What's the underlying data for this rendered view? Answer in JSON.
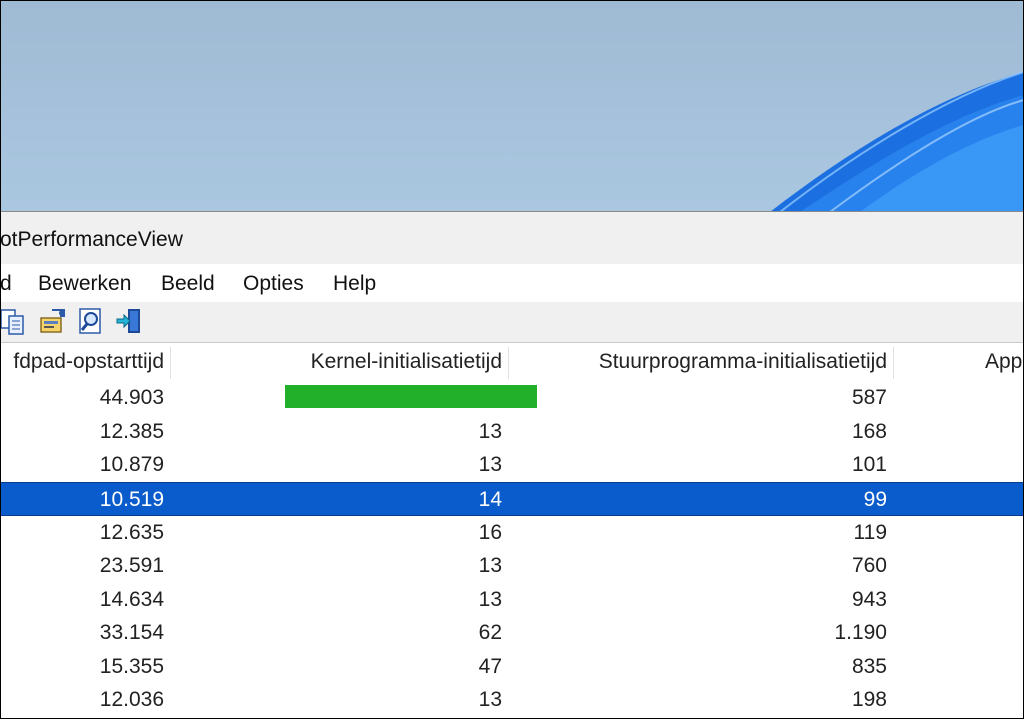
{
  "window": {
    "title": "otPerformanceView"
  },
  "menu": [
    "d",
    "Bewerken",
    "Beeld",
    "Opties",
    "Help"
  ],
  "toolbar_icons": [
    "copy-icon",
    "properties-icon",
    "find-icon",
    "exit-icon"
  ],
  "columns": [
    "fdpad-opstarttijd",
    "Kernel-initialisatietijd",
    "Stuurprogramma-initialisatietijd",
    "App"
  ],
  "rows": [
    {
      "boot": "44.903",
      "kernel": "",
      "kernel_bar_percent": 100,
      "driver": "587",
      "selected": false
    },
    {
      "boot": "12.385",
      "kernel": "13",
      "driver": "168",
      "selected": false
    },
    {
      "boot": "10.879",
      "kernel": "13",
      "driver": "101",
      "selected": false
    },
    {
      "boot": "10.519",
      "kernel": "14",
      "driver": "99",
      "selected": true
    },
    {
      "boot": "12.635",
      "kernel": "16",
      "driver": "119",
      "selected": false
    },
    {
      "boot": "23.591",
      "kernel": "13",
      "driver": "760",
      "selected": false
    },
    {
      "boot": "14.634",
      "kernel": "13",
      "driver": "943",
      "selected": false
    },
    {
      "boot": "33.154",
      "kernel": "62",
      "driver": "1.190",
      "selected": false
    },
    {
      "boot": "15.355",
      "kernel": "47",
      "driver": "835",
      "selected": false
    },
    {
      "boot": "12.036",
      "kernel": "13",
      "driver": "198",
      "selected": false
    }
  ],
  "colors": {
    "selection": "#0a5ccc",
    "bar": "#22b02a"
  }
}
